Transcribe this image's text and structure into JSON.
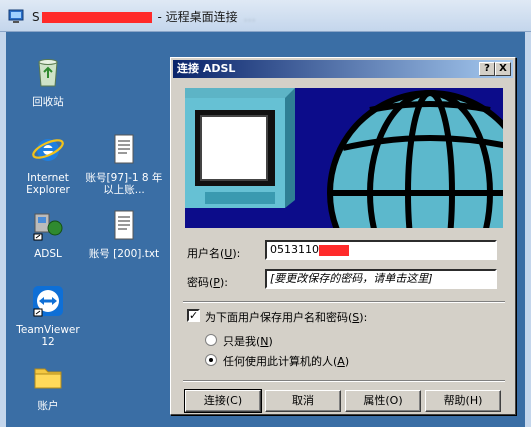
{
  "window": {
    "title_prefix": "S",
    "title_suffix": " - 远程桌面连接",
    "title_blurred": "…",
    "accent": "#0a246a"
  },
  "desktop": {
    "icons": [
      {
        "name": "recycle-bin",
        "label": "回收站"
      },
      {
        "name": "internet-explorer",
        "label": "Internet Explorer"
      },
      {
        "name": "account-file-97",
        "label": "账号[97]-1 8 年以上账..."
      },
      {
        "name": "adsl",
        "label": "ADSL"
      },
      {
        "name": "account-file-200",
        "label": "账号 [200].txt"
      },
      {
        "name": "teamviewer",
        "label": "TeamViewer 12"
      },
      {
        "name": "account-folder",
        "label": "账户"
      }
    ]
  },
  "dialog": {
    "title": "连接 ADSL",
    "help_btn": "?",
    "close_btn": "X",
    "username_label": "用户名",
    "username_key": "U",
    "username_value": "0513110",
    "password_label": "密码",
    "password_key": "P",
    "password_value": "[要更改保存的密码，请单击这里]",
    "save_label": "为下面用户保存用户名和密码",
    "save_key": "S",
    "save_checked": true,
    "only_me_label": "只是我",
    "only_me_key": "N",
    "anyone_label": "任何使用此计算机的人",
    "anyone_key": "A",
    "selected_option": "anyone",
    "buttons": {
      "connect": "连接(C)",
      "cancel": "取消",
      "properties": "属性(O)",
      "help": "帮助(H)"
    }
  }
}
